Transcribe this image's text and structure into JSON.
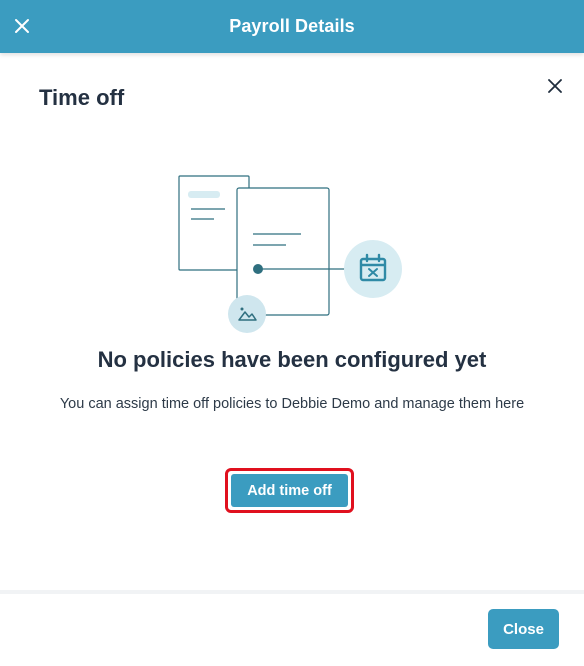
{
  "header": {
    "title": "Payroll Details",
    "close_icon": "close-icon"
  },
  "panel": {
    "heading": "Time off",
    "close_icon": "close-icon"
  },
  "empty_state": {
    "illustration_icons": [
      "document-icon",
      "calendar-x-icon",
      "image-icon"
    ],
    "title": "No policies have been configured yet",
    "description": "You can assign time off policies to Debbie Demo and manage them here",
    "add_button_label": "Add time off",
    "highlight_color": "#e0101e"
  },
  "footer": {
    "close_button_label": "Close"
  },
  "colors": {
    "accent": "#3b9cc0",
    "text_dark": "#243142",
    "illustration_stroke": "#2f6f7f",
    "illustration_fill": "#d7ecf2"
  }
}
